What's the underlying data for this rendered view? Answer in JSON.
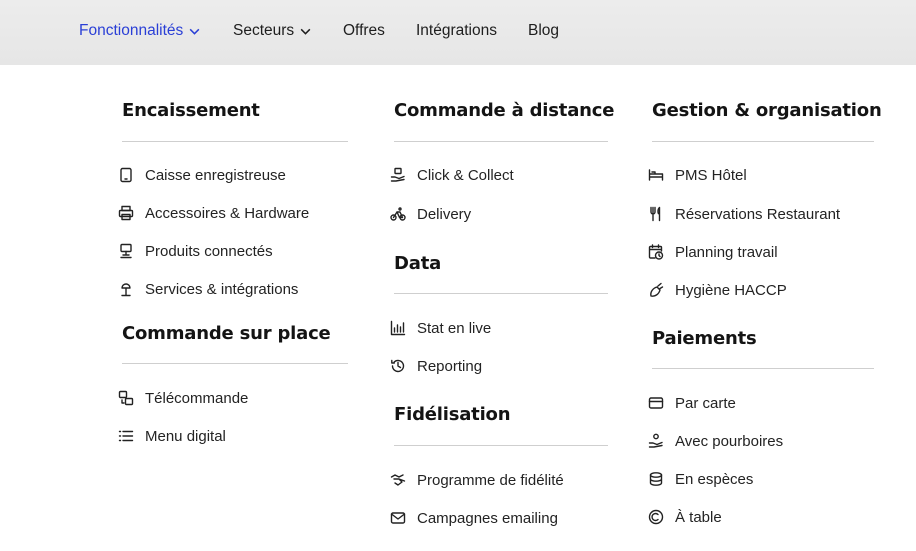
{
  "nav": {
    "items": [
      {
        "label": "Fonctionnalités"
      },
      {
        "label": "Secteurs"
      },
      {
        "label": "Offres"
      },
      {
        "label": "Intégrations"
      },
      {
        "label": "Blog"
      }
    ],
    "active_color": "#2a3fd6"
  },
  "menu": {
    "col1": {
      "encaissement": {
        "title": "Encaissement",
        "items": [
          {
            "label": "Caisse enregistreuse",
            "icon": "tablet-icon"
          },
          {
            "label": "Accessoires & Hardware",
            "icon": "printer-icon"
          },
          {
            "label": "Produits connectés",
            "icon": "terminal-icon"
          },
          {
            "label": "Services & intégrations",
            "icon": "plug-icon"
          }
        ]
      },
      "commande_sur_place": {
        "title": "Commande sur place",
        "items": [
          {
            "label": "Télécommande",
            "icon": "remote-icon"
          },
          {
            "label": "Menu digital",
            "icon": "list-icon"
          }
        ]
      }
    },
    "col2": {
      "commande_a_distance": {
        "title": "Commande à distance",
        "items": [
          {
            "label": "Click & Collect",
            "icon": "bag-hand-icon"
          },
          {
            "label": "Delivery",
            "icon": "bike-icon"
          }
        ]
      },
      "data": {
        "title": "Data",
        "items": [
          {
            "label": "Stat en live",
            "icon": "chart-icon"
          },
          {
            "label": "Reporting",
            "icon": "history-icon"
          }
        ]
      },
      "fidelisation": {
        "title": "Fidélisation",
        "items": [
          {
            "label": "Programme de fidélité",
            "icon": "handshake-icon"
          },
          {
            "label": "Campagnes emailing",
            "icon": "mail-icon"
          }
        ]
      }
    },
    "col3": {
      "gestion": {
        "title": "Gestion & organisation",
        "items": [
          {
            "label": "PMS Hôtel",
            "icon": "bed-icon"
          },
          {
            "label": "Réservations Restaurant",
            "icon": "cutlery-icon"
          },
          {
            "label": "Planning travail",
            "icon": "calendar-clock-icon"
          },
          {
            "label": "Hygiène HACCP",
            "icon": "spray-icon"
          }
        ]
      },
      "paiements": {
        "title": "Paiements",
        "items": [
          {
            "label": "Par carte",
            "icon": "card-icon"
          },
          {
            "label": "Avec pourboires",
            "icon": "tip-hand-icon"
          },
          {
            "label": "En espèces",
            "icon": "coins-icon"
          },
          {
            "label": "À table",
            "icon": "contactless-icon"
          }
        ]
      }
    }
  }
}
